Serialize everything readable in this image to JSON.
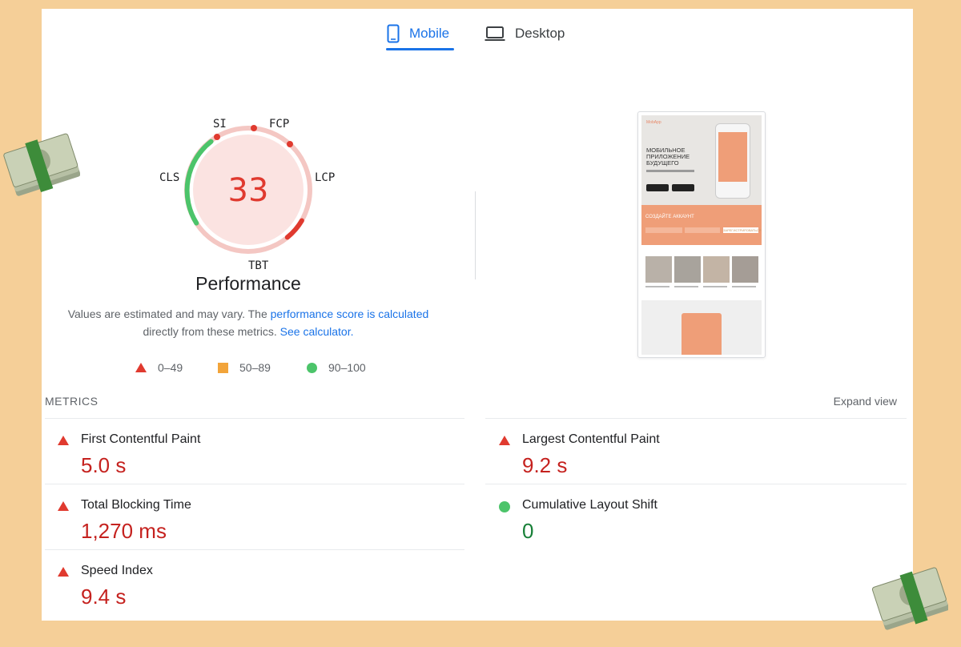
{
  "tabs": [
    {
      "label": "Mobile",
      "icon": "smartphone-icon",
      "active": true
    },
    {
      "label": "Desktop",
      "icon": "laptop-icon",
      "active": false
    }
  ],
  "gauge": {
    "score": "33",
    "labels": {
      "si": "SI",
      "fcp": "FCP",
      "lcp": "LCP",
      "tbt": "TBT",
      "cls": "CLS"
    },
    "title": "Performance",
    "colors": {
      "bad": "#e03a2f",
      "bad_bg": "#fbe3e1",
      "track": "#f4c7c3",
      "good": "#4cc46a"
    }
  },
  "description": {
    "text1": "Values are estimated and may vary. The ",
    "link1": "performance score is calculated",
    "text2": "directly from these metrics. ",
    "link2": "See calculator."
  },
  "legend": [
    {
      "range": "0–49",
      "shape": "triangle",
      "color": "#e03a2f"
    },
    {
      "range": "50–89",
      "shape": "square",
      "color": "#f2a43a"
    },
    {
      "range": "90–100",
      "shape": "circle",
      "color": "#4cc46a"
    }
  ],
  "metrics": {
    "header": "METRICS",
    "expand_label": "Expand view",
    "items": [
      {
        "name": "First Contentful Paint",
        "value": "5.0 s",
        "status": "bad"
      },
      {
        "name": "Largest Contentful Paint",
        "value": "9.2 s",
        "status": "bad"
      },
      {
        "name": "Total Blocking Time",
        "value": "1,270 ms",
        "status": "bad"
      },
      {
        "name": "Cumulative Layout Shift",
        "value": "0",
        "status": "good"
      },
      {
        "name": "Speed Index",
        "value": "9.4 s",
        "status": "bad"
      }
    ]
  },
  "thumbnail": {
    "logo": "MobApp",
    "heading": "МОБИЛЬНОЕ ПРИЛОЖЕНИЕ БУДУЩЕГО",
    "cta_title": "СОЗДАЙТЕ АККАУНТ",
    "cta_button": "ЗАРЕГИСТРИРОВАТЬСЯ"
  }
}
